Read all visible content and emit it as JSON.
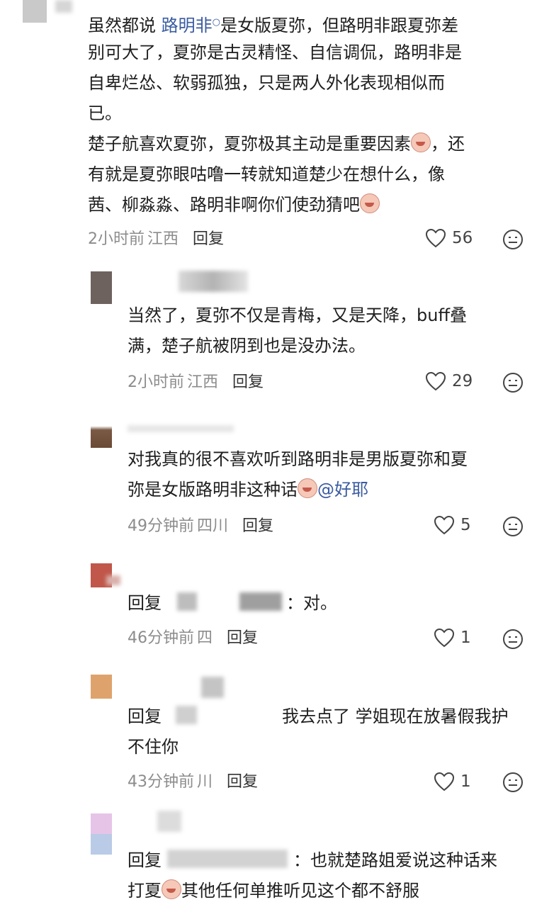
{
  "comments": [
    {
      "lines": [
        {
          "pre": "虽然都说 ",
          "link": "路明非",
          "post": "是女版夏弥，但路明非跟夏弥差"
        },
        {
          "text": "别可大了，夏弥是古灵精怪、自信调侃，路明非是"
        },
        {
          "text": "自卑烂怂、软弱孤独，只是两人外化表现相似而"
        },
        {
          "text": "已。"
        },
        {
          "pre": "楚子航喜欢夏弥，夏弥极其主动是重要因素",
          "post": "，还"
        },
        {
          "text": "有就是夏弥眼咕噜一转就知道楚少在想什么，像"
        },
        {
          "pre": "茜、柳淼淼、路明非啊你们使劲猜吧",
          "post": ""
        }
      ],
      "time": "2小时前",
      "location": "江西",
      "reply": "回复",
      "likes": "56"
    },
    {
      "lines": [
        {
          "text": "当然了，夏弥不仅是青梅，又是天降，buff叠"
        },
        {
          "text": "满，楚子航被阴到也是没办法。"
        }
      ],
      "time": "2小时前",
      "location": "江西",
      "reply": "回复",
      "likes": "29"
    },
    {
      "lines": [
        {
          "text": "对我真的很不喜欢听到路明非是男版夏弥和夏"
        },
        {
          "pre": "弥是女版路明非这种话",
          "post": "@好耶"
        }
      ],
      "time": "49分钟前",
      "location": "四川",
      "reply": "回复",
      "likes": "5"
    },
    {
      "lines": [
        {
          "pre": "回复",
          "post": "：对。"
        }
      ],
      "time": "46分钟前",
      "location": "四",
      "reply": "回复",
      "likes": "1"
    },
    {
      "lines": [
        {
          "pre": "回复",
          "post": "我去点了 学姐现在放暑假我护"
        },
        {
          "text": "不住你"
        }
      ],
      "time": "43分钟前",
      "location": "川",
      "reply": "回复",
      "likes": "1"
    },
    {
      "lines": [
        {
          "pre": "回复",
          "post": "：也就楚路姐爱说这种话来"
        },
        {
          "pre": "打夏",
          "post": "其他任何单推听见这个都不舒服"
        }
      ]
    }
  ],
  "icons": {
    "like": "heart-outline-icon",
    "emoji": "emoji-face-icon",
    "search_hint": "search-icon"
  },
  "colors": {
    "link": "#3a5ba0",
    "meta": "#8c8c8c",
    "text": "#1e1e1e"
  }
}
